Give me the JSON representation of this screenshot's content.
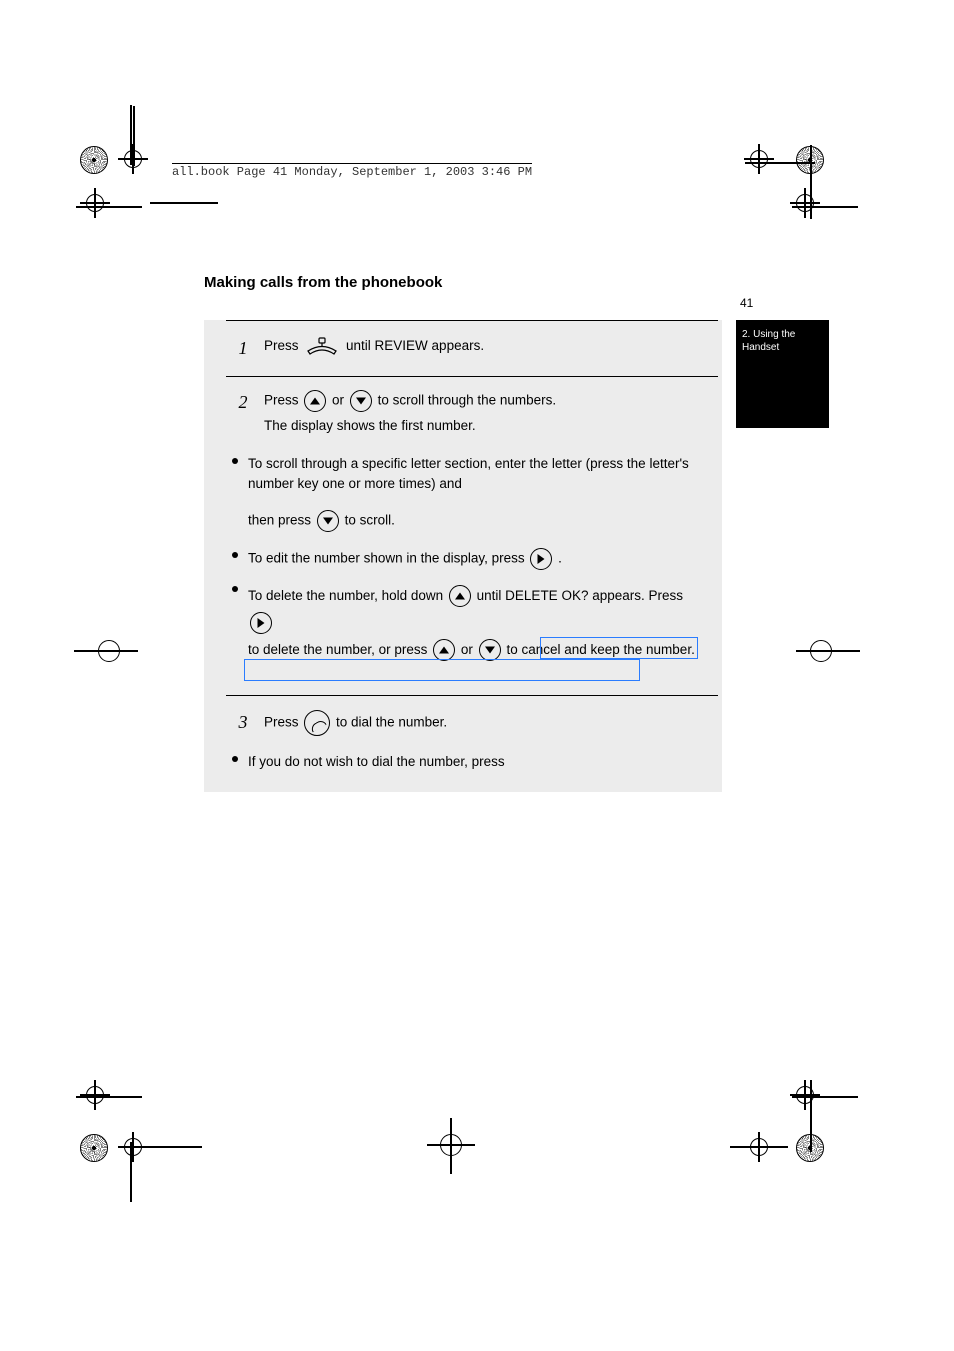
{
  "header": "all.book  Page 41  Monday, September 1, 2003  3:46 PM",
  "section_heading": "Making calls from the phonebook",
  "page_number": "41",
  "tab": {
    "line1": "2. Using the",
    "line2": "Handset"
  },
  "steps": {
    "s1": {
      "num": "1",
      "text_before": "Press ",
      "text_after": " until REVIEW appears."
    },
    "s2": {
      "num": "2",
      "lead_before": "Press ",
      "lead_mid": " or ",
      "lead_after": " to scroll through the numbers.",
      "display": "The display shows the first number.",
      "bullet1a": "To scroll through a specific letter section, enter the letter (press the letter's number key one or more times) and",
      "bullet1b_before": "then press ",
      "bullet1b_after": " to scroll.",
      "bullet2_before": "To edit the number shown in the display, press ",
      "bullet2_after": ".",
      "bullet3a_before": "To delete the number, hold down ",
      "bullet3a_mid": " until DELETE OK? appears. Press ",
      "bullet3b_before": "to delete the number,",
      "bullet3b_mid": " or press ",
      "bullet3b_or": " or ",
      "bullet3b_after": " to cancel and keep the number."
    },
    "s3": {
      "num": "3",
      "text_before": "Press ",
      "text_after": " to dial the number.",
      "bullet": "If you do not wish to dial the number, press"
    }
  }
}
